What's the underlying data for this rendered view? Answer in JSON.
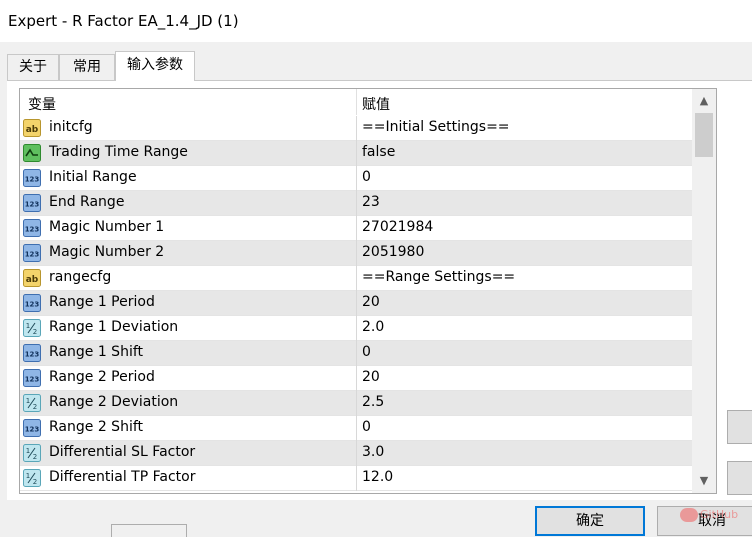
{
  "window": {
    "title": "Expert - R Factor EA_1.4_JD (1)"
  },
  "tabs": [
    {
      "label": "关于",
      "active": false
    },
    {
      "label": "常用",
      "active": false
    },
    {
      "label": "输入参数",
      "active": true
    }
  ],
  "grid": {
    "columns": {
      "variable": "变量",
      "value": "赋值"
    },
    "rows": [
      {
        "type": "string",
        "icon": "string-ab-icon",
        "name": "initcfg",
        "value": "==Initial Settings=="
      },
      {
        "type": "bool",
        "icon": "bool-icon",
        "name": "Trading Time Range",
        "value": "false"
      },
      {
        "type": "int",
        "icon": "int-123-icon",
        "name": "Initial Range",
        "value": "0"
      },
      {
        "type": "int",
        "icon": "int-123-icon",
        "name": "End Range",
        "value": "23"
      },
      {
        "type": "int",
        "icon": "int-123-icon",
        "name": "Magic Number 1",
        "value": "27021984"
      },
      {
        "type": "int",
        "icon": "int-123-icon",
        "name": "Magic Number 2",
        "value": "2051980"
      },
      {
        "type": "string",
        "icon": "string-ab-icon",
        "name": "rangecfg",
        "value": "==Range Settings=="
      },
      {
        "type": "int",
        "icon": "int-123-icon",
        "name": "Range 1 Period",
        "value": "20"
      },
      {
        "type": "double",
        "icon": "double-half-icon",
        "name": "Range 1 Deviation",
        "value": "2.0"
      },
      {
        "type": "int",
        "icon": "int-123-icon",
        "name": "Range 1 Shift",
        "value": "0"
      },
      {
        "type": "int",
        "icon": "int-123-icon",
        "name": "Range 2 Period",
        "value": "20"
      },
      {
        "type": "double",
        "icon": "double-half-icon",
        "name": "Range 2 Deviation",
        "value": "2.5"
      },
      {
        "type": "int",
        "icon": "int-123-icon",
        "name": "Range 2 Shift",
        "value": "0"
      },
      {
        "type": "double",
        "icon": "double-half-icon",
        "name": "Differential SL Factor",
        "value": "3.0"
      },
      {
        "type": "double",
        "icon": "double-half-icon",
        "name": "Differential TP Factor",
        "value": "12.0"
      }
    ]
  },
  "buttons": {
    "ok": "确定",
    "cancel": "取消"
  },
  "watermark": "GitHub"
}
